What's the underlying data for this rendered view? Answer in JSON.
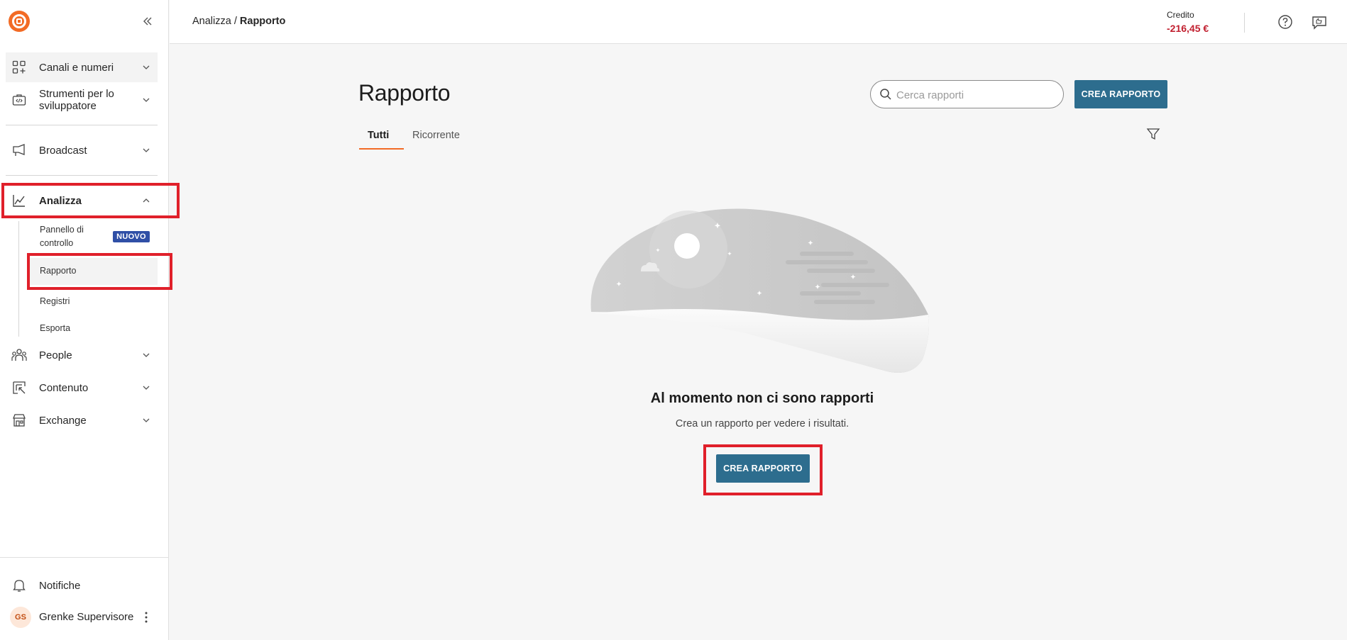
{
  "sidebar": {
    "logo_icon": "brand-logo-icon",
    "collapse_icon": "double-chevron-left-icon",
    "items": [
      {
        "label": "Canali e numeri",
        "icon": "grid-plus-icon"
      },
      {
        "label": "Strumenti per lo sviluppatore",
        "line1": "Strumenti per lo",
        "line2": "sviluppatore",
        "icon": "code-toolbox-icon"
      },
      {
        "label": "Broadcast",
        "icon": "megaphone-icon"
      },
      {
        "label": "Analizza",
        "icon": "chart-line-icon",
        "expanded": true
      },
      {
        "label": "People",
        "icon": "people-icon"
      },
      {
        "label": "Contenuto",
        "icon": "content-icon"
      },
      {
        "label": "Exchange",
        "icon": "store-icon"
      }
    ],
    "analizza_sub": [
      {
        "label": "Pannello di controllo",
        "line1": "Pannello di",
        "line2": "controllo",
        "badge": "NUOVO"
      },
      {
        "label": "Rapporto",
        "active": true
      },
      {
        "label": "Registri"
      },
      {
        "label": "Esporta"
      }
    ],
    "notifications": {
      "label": "Notifiche",
      "icon": "bell-icon"
    },
    "user": {
      "initials": "GS",
      "name": "Grenke Supervisore",
      "menu_icon": "kebab-menu-icon"
    }
  },
  "topbar": {
    "breadcrumb_parent": "Analizza",
    "breadcrumb_sep": " / ",
    "breadcrumb_current": "Rapporto",
    "credit_label": "Credito",
    "credit_value": "-216,45 €",
    "help_icon": "help-circle-icon",
    "feedback_icon": "feedback-icon"
  },
  "main": {
    "title": "Rapporto",
    "search_placeholder": "Cerca rapporti",
    "create_button": "CREA RAPPORTO",
    "tabs": [
      {
        "label": "Tutti",
        "active": true
      },
      {
        "label": "Ricorrente",
        "active": false
      }
    ],
    "filter_icon": "filter-icon",
    "empty_title": "Al momento non ci sono rapporti",
    "empty_subtitle": "Crea un rapporto per vedere i risultati.",
    "empty_button": "CREA RAPPORTO"
  },
  "colors": {
    "accent_orange": "#f26b25",
    "primary_button": "#2d6d8e",
    "credit_negative": "#c11f2f",
    "badge_blue": "#2f4fa6",
    "highlight_red": "#e0202a"
  }
}
